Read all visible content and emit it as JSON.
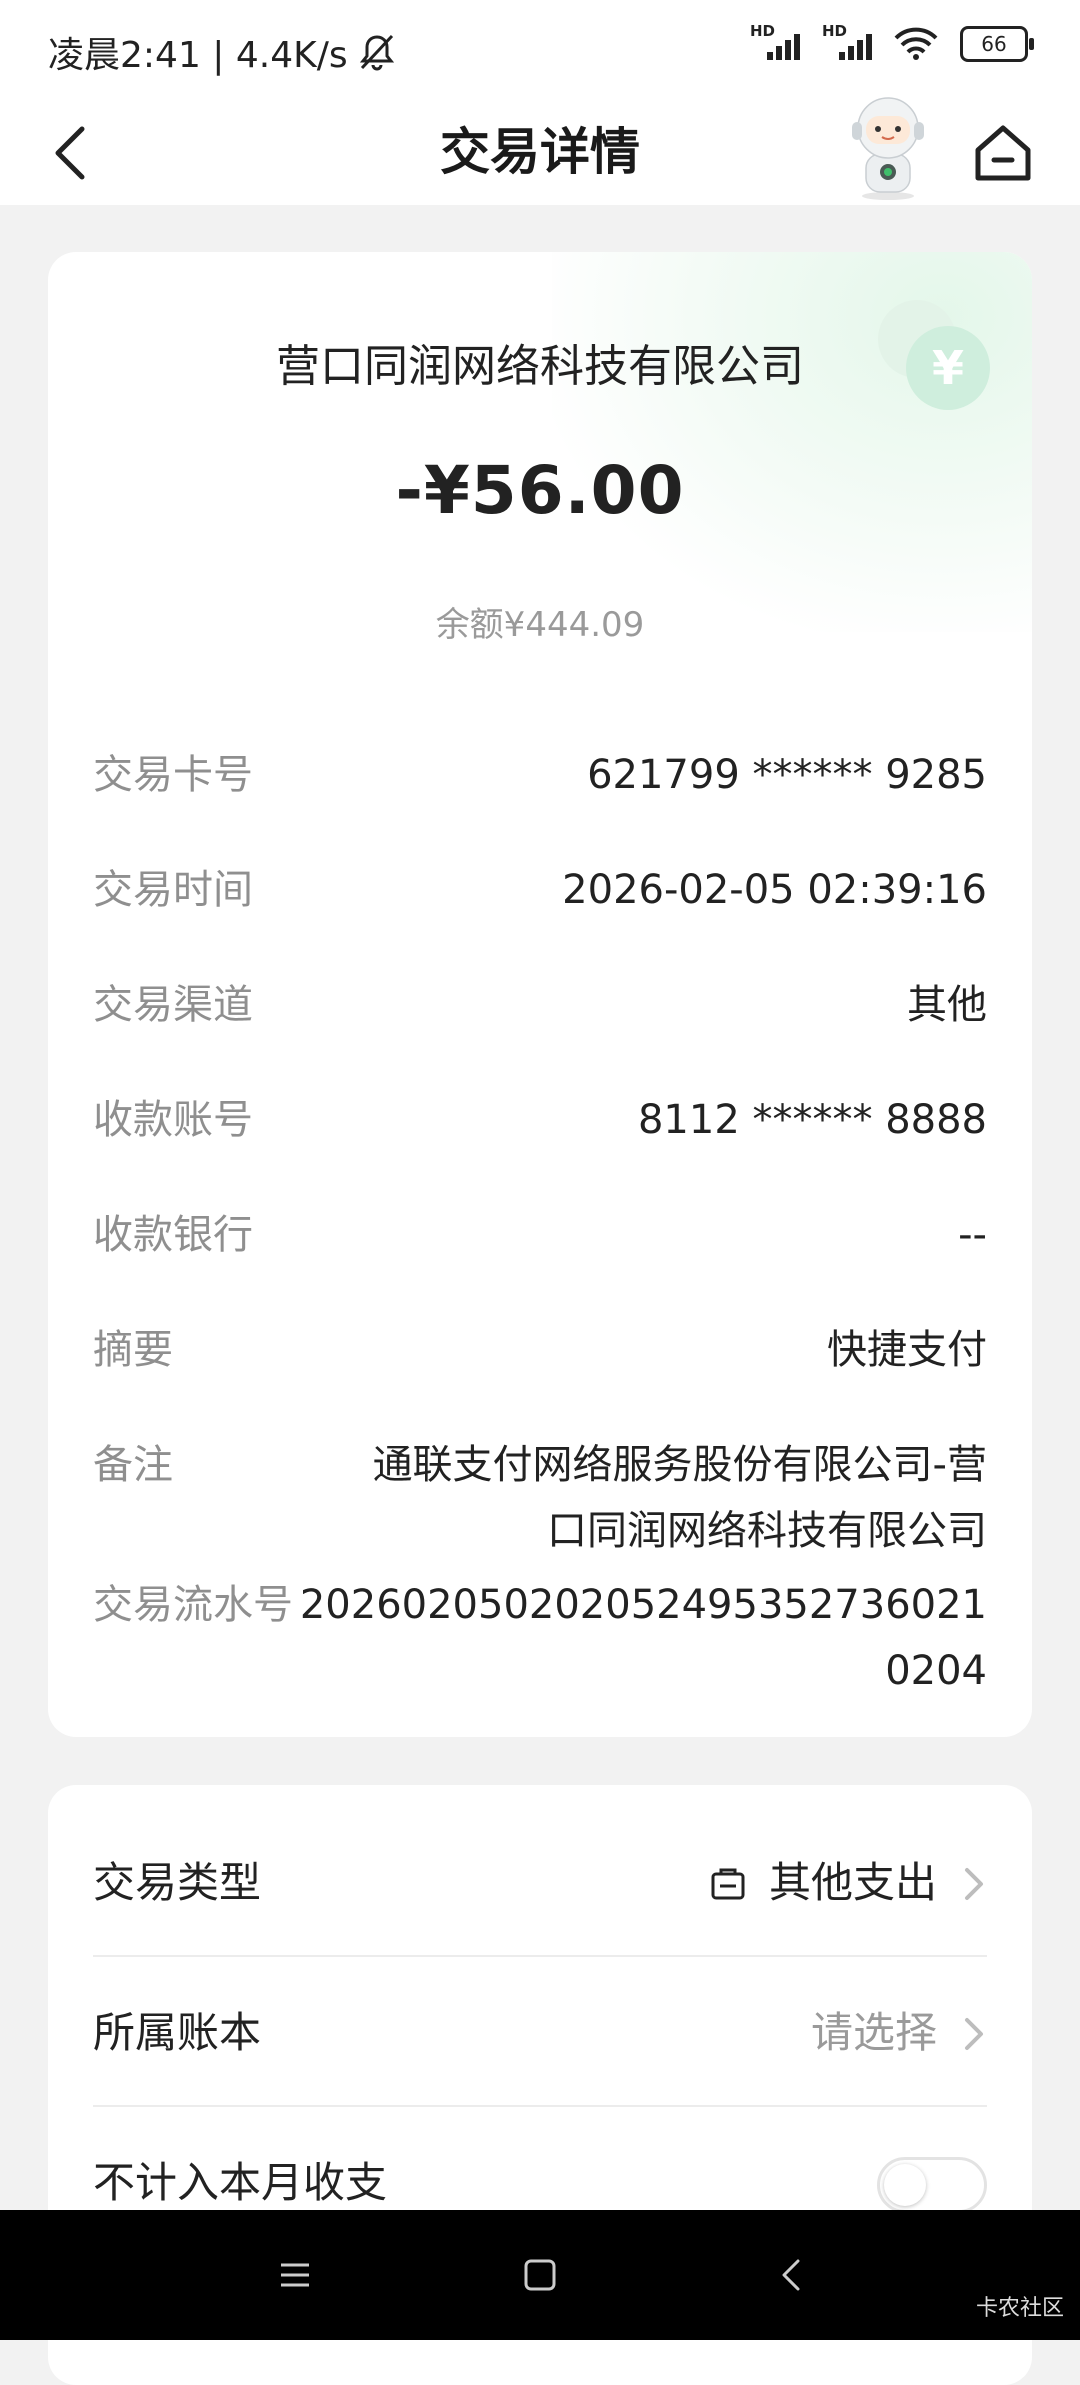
{
  "status_bar": {
    "time_text": "凌晨2:41 | 4.4K/s",
    "signal_labels": [
      "HD",
      "HD"
    ],
    "battery": "66"
  },
  "nav": {
    "title": "交易详情",
    "icons": [
      "back-icon",
      "robot-assistant-icon",
      "home-icon"
    ]
  },
  "transaction": {
    "merchant": "营口同润网络科技有限公司",
    "amount": "-¥56.00",
    "balance": "余额¥444.09",
    "coin_symbol": "¥",
    "details": [
      {
        "label": "交易卡号",
        "value": "621799 ****** 9285"
      },
      {
        "label": "交易时间",
        "value": "2026-02-05 02:39:16"
      },
      {
        "label": "交易渠道",
        "value": "其他"
      },
      {
        "label": "收款账号",
        "value": "8112 ****** 8888"
      },
      {
        "label": "收款银行",
        "value": "--"
      },
      {
        "label": "摘要",
        "value": "快捷支付"
      },
      {
        "label": "备注",
        "value_line1": "通联支付网络服务股份有限公司-营",
        "value_line2": "口同润网络科技有限公司"
      },
      {
        "label": "交易流水号",
        "value_line1": "20260205020205249535273602​1",
        "value_line2": "0204"
      }
    ]
  },
  "settings": {
    "transaction_type": {
      "label": "交易类型",
      "value": "其他支出"
    },
    "account_book": {
      "label": "所属账本",
      "value": "请选择"
    },
    "exclude_month": {
      "label": "不计入本月收支",
      "enabled": false
    }
  },
  "watermark": "卡农社区",
  "colors": {
    "accent_green": "#cfeedd",
    "muted_text": "#8f8f8f"
  }
}
